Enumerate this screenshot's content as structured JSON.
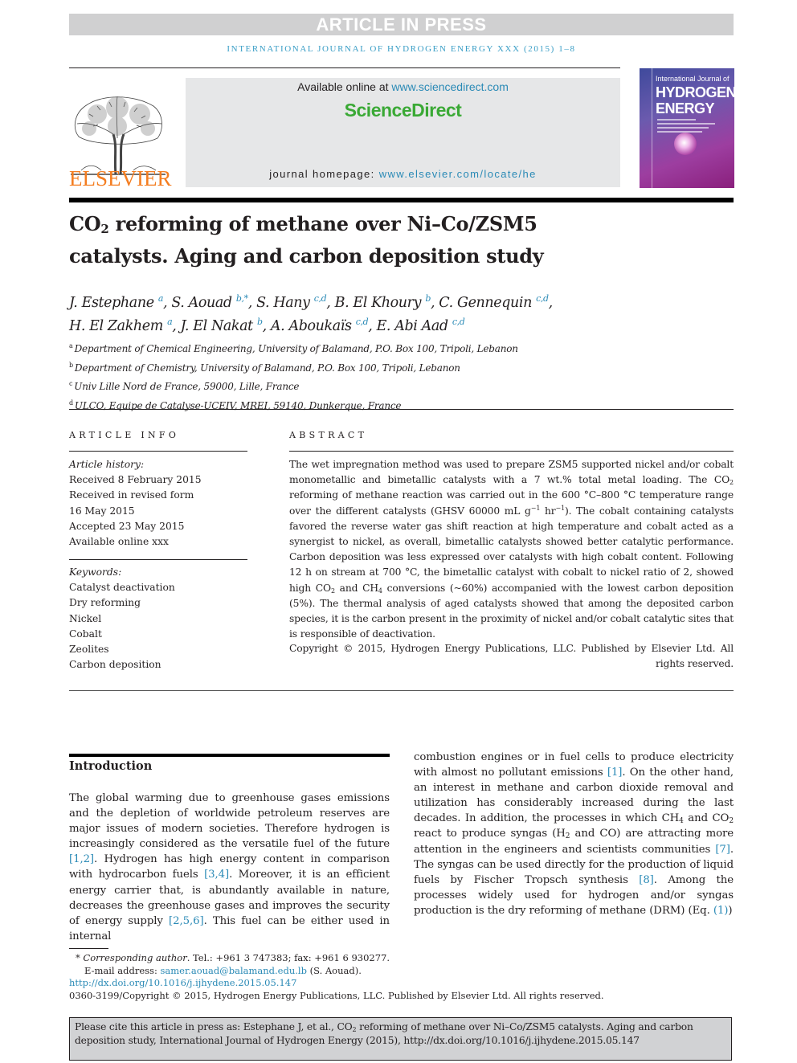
{
  "banner": {
    "text": "ARTICLE IN PRESS"
  },
  "running_head": "INTERNATIONAL JOURNAL OF HYDROGEN ENERGY XXX (2015) 1–8",
  "masthead": {
    "publisher_logo": "ELSEVIER",
    "available_prefix": "Available online at ",
    "available_link": "www.sciencedirect.com",
    "platform_logo": "ScienceDirect",
    "homepage_prefix": "journal homepage: ",
    "homepage_link": "www.elsevier.com/locate/he",
    "cover": {
      "line1": "International Journal of",
      "line2": "HYDROGEN",
      "line3": "ENERGY"
    }
  },
  "article": {
    "title_pre": "CO",
    "title_sub": "2",
    "title_post": " reforming of methane over Ni–Co/ZSM5 catalysts. Aging and carbon deposition study",
    "authors": [
      {
        "name": "J. Estephane",
        "aff": "a",
        "sep": ", "
      },
      {
        "name": "S. Aouad",
        "aff": "b,*",
        "sep": ", "
      },
      {
        "name": "S. Hany",
        "aff": "c,d",
        "sep": ", "
      },
      {
        "name": "B. El Khoury",
        "aff": "b",
        "sep": ", "
      },
      {
        "name": "C. Gennequin",
        "aff": "c,d",
        "sep": ","
      },
      {
        "name": "H. El Zakhem",
        "aff": "a",
        "sep": ", "
      },
      {
        "name": "J. El Nakat",
        "aff": "b",
        "sep": ", "
      },
      {
        "name": "A. Aboukaïs",
        "aff": "c,d",
        "sep": ", "
      },
      {
        "name": "E. Abi Aad",
        "aff": "c,d",
        "sep": ""
      }
    ],
    "affiliations": [
      {
        "key": "a",
        "text": "Department of Chemical Engineering, University of Balamand, P.O. Box 100, Tripoli, Lebanon"
      },
      {
        "key": "b",
        "text": "Department of Chemistry, University of Balamand, P.O. Box 100, Tripoli, Lebanon"
      },
      {
        "key": "c",
        "text": "Univ Lille Nord de France, 59000, Lille, France"
      },
      {
        "key": "d",
        "text": "ULCO, Equipe de Catalyse-UCEIV, MREI, 59140, Dunkerque, France"
      }
    ]
  },
  "article_info": {
    "heading": "ARTICLE INFO",
    "history_label": "Article history:",
    "history": [
      "Received 8 February 2015",
      "Received in revised form",
      "16 May 2015",
      "Accepted 23 May 2015",
      "Available online xxx"
    ],
    "keywords_label": "Keywords:",
    "keywords": [
      "Catalyst deactivation",
      "Dry reforming",
      "Nickel",
      "Cobalt",
      "Zeolites",
      "Carbon deposition"
    ]
  },
  "abstract": {
    "heading": "ABSTRACT",
    "p1": "The wet impregnation method was used to prepare ZSM5 supported nickel and/or cobalt monometallic and bimetallic catalysts with a 7 wt.% total metal loading. The CO",
    "p2": " reforming of methane reaction was carried out in the 600 °C–800 °C temperature range over the different catalysts (GHSV 60000 mL g",
    "p3": " hr",
    "p4": "). The cobalt containing catalysts favored the reverse water gas shift reaction at high temperature and cobalt acted as a synergist to nickel, as overall, bimetallic catalysts showed better catalytic performance. Carbon deposition was less expressed over catalysts with high cobalt content. Following 12 h on stream at 700 °C, the bimetallic catalyst with cobalt to nickel ratio of 2, showed high CO",
    "p5": " and CH",
    "p6": " conversions (~60%) accompanied with the lowest carbon deposition (5%). The thermal analysis of aged catalysts showed that among the deposited carbon species, it is the carbon present in the proximity of nickel and/or cobalt catalytic sites that is responsible of deactivation.",
    "sub2": "2",
    "sub4": "4",
    "sup_neg1": "−1",
    "copyright": "Copyright © 2015, Hydrogen Energy Publications, LLC. Published by Elsevier Ltd. All rights reserved."
  },
  "introduction": {
    "heading": "Introduction",
    "left": {
      "t1": "The global warming due to greenhouse gases emissions and the depletion of worldwide petroleum reserves are major issues of modern societies. Therefore hydrogen is increasingly considered as the versatile fuel of the future ",
      "r1": "[1,2]",
      "t2": ". Hydrogen has high energy content in comparison with hydrocarbon fuels ",
      "r2": "[3,4]",
      "t3": ". Moreover, it is an efficient energy carrier that, is abundantly available in nature, decreases the greenhouse gases and improves the security of energy supply ",
      "r3": "[2,5,6]",
      "t4": ". This fuel can be either used in internal"
    },
    "right": {
      "t1": "combustion engines or in fuel cells to produce electricity with almost no pollutant emissions ",
      "r1": "[1]",
      "t2": ". On the other hand, an interest in methane and carbon dioxide removal and utilization has considerably increased during the last decades. In addition, the processes in which CH",
      "t3": " and CO",
      "t4": " react to produce syngas (H",
      "t5": " and CO) are attracting more attention in the engineers and scientists communities ",
      "r2": "[7]",
      "t6": ". The syngas can be used directly for the production of liquid fuels by Fischer Tropsch synthesis ",
      "r3": "[8]",
      "t7": ". Among the processes widely used for hydrogen and/or syngas production is the dry reforming of methane (DRM) (Eq. ",
      "r4": "(1)",
      "t8": ")"
    }
  },
  "footnotes": {
    "star": "* ",
    "corr_label": "Corresponding author",
    "corr_text": ". Tel.: +961 3 747383; fax: +961 6 930277.",
    "email_label": "E-mail address: ",
    "email": "samer.aouad@balamand.edu.lb",
    "email_suffix": " (S. Aouad).",
    "doi": "http://dx.doi.org/10.1016/j.ijhydene.2015.05.147",
    "issn_copyright": "0360-3199/Copyright © 2015, Hydrogen Energy Publications, LLC. Published by Elsevier Ltd. All rights reserved."
  },
  "citation": {
    "pre": "Please cite this article in press as: Estephane J, et al., CO",
    "sub": "2",
    "post": " reforming of methane over Ni–Co/ZSM5 catalysts. Aging and carbon deposition study, International Journal of Hydrogen Energy (2015), http://dx.doi.org/10.1016/j.ijhydene.2015.05.147"
  },
  "colors": {
    "link": "#2a8ab6",
    "banner_bg": "#d0d0d1",
    "sciencedirect_green": "#3aa935",
    "elsevier_orange": "#f47d20",
    "citation_bg": "#d1d2d4"
  }
}
